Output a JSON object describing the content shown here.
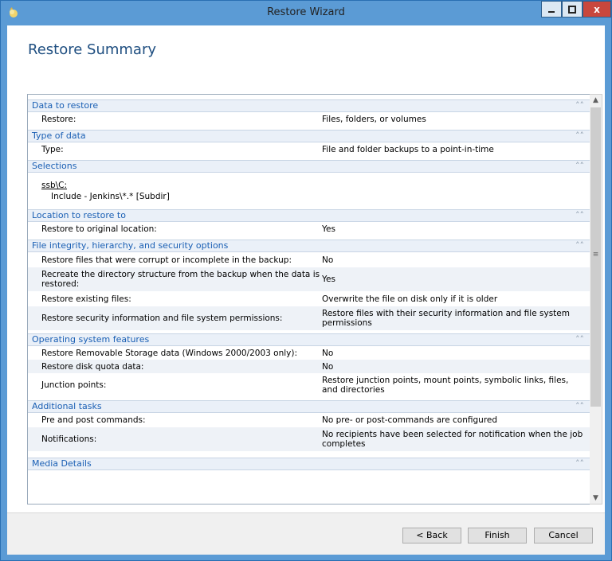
{
  "window": {
    "title": "Restore Wizard",
    "close_glyph": "x"
  },
  "page": {
    "heading": "Restore Summary"
  },
  "sections": {
    "data_to_restore": {
      "header": "Data to restore",
      "rows": [
        {
          "label": "Restore:",
          "value": "Files, folders, or volumes"
        }
      ]
    },
    "type_of_data": {
      "header": "Type of data",
      "rows": [
        {
          "label": "Type:",
          "value": "File and folder backups to a point-in-time"
        }
      ]
    },
    "selections": {
      "header": "Selections",
      "path": "ssb\\C:",
      "include": "Include - Jenkins\\*.* [Subdir]"
    },
    "location": {
      "header": "Location to restore to",
      "rows": [
        {
          "label": "Restore to original location:",
          "value": "Yes"
        }
      ]
    },
    "integrity": {
      "header": "File integrity, hierarchy, and security options",
      "rows": [
        {
          "label": "Restore files that were corrupt or incomplete in the backup:",
          "value": "No"
        },
        {
          "label": "Recreate the directory structure from the backup when the data is restored:",
          "value": "Yes"
        },
        {
          "label": "Restore existing files:",
          "value": "Overwrite the file on disk only if it is older"
        },
        {
          "label": "Restore security information and file system permissions:",
          "value": "Restore files with their security information and file system permissions"
        }
      ]
    },
    "os_features": {
      "header": "Operating system features",
      "rows": [
        {
          "label": "Restore Removable Storage data (Windows 2000/2003 only):",
          "value": "No"
        },
        {
          "label": "Restore disk quota data:",
          "value": "No"
        },
        {
          "label": "Junction points:",
          "value": "Restore junction points, mount points, symbolic links, files, and directories"
        }
      ]
    },
    "additional_tasks": {
      "header": "Additional tasks",
      "rows": [
        {
          "label": "Pre and post commands:",
          "value": "No pre- or post-commands are configured"
        },
        {
          "label": "Notifications:",
          "value": "No recipients have been selected for notification when the job completes"
        }
      ]
    },
    "media_details": {
      "header": "Media Details"
    }
  },
  "buttons": {
    "back": "< Back",
    "finish": "Finish",
    "cancel": "Cancel"
  },
  "colors": {
    "titlebar": "#5b9bd5",
    "section_text": "#1a5fb4",
    "close_button": "#c9473d"
  }
}
